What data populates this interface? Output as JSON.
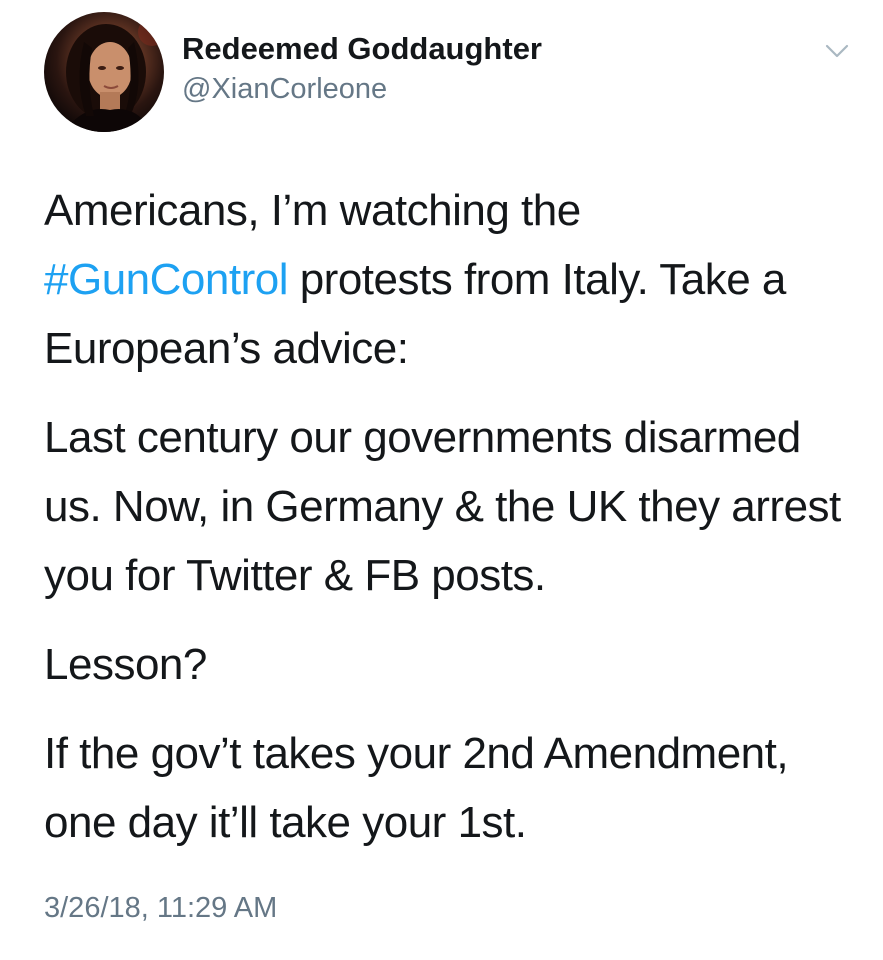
{
  "tweet": {
    "author": {
      "display_name": "Redeemed Goddaughter",
      "handle": "@XianCorleone",
      "avatar_icon": "profile-photo"
    },
    "menu_icon": "chevron-down-icon",
    "body": {
      "p1_pre": "Americans, I’m watching the",
      "hashtag": "#GunControl",
      "p1_post": " protests from Italy. Take a European’s advice:",
      "p2": "Last century our governments disarmed us. Now, in Germany & the UK they arrest you for Twitter & FB posts.",
      "p3": "Lesson?",
      "p4": "If the gov’t takes your 2nd Amendment, one day it’ll take your 1st."
    },
    "timestamp": "3/26/18, 11:29 AM"
  },
  "colors": {
    "text": "#14171a",
    "secondary": "#657786",
    "link": "#1da1f2",
    "background": "#ffffff"
  }
}
